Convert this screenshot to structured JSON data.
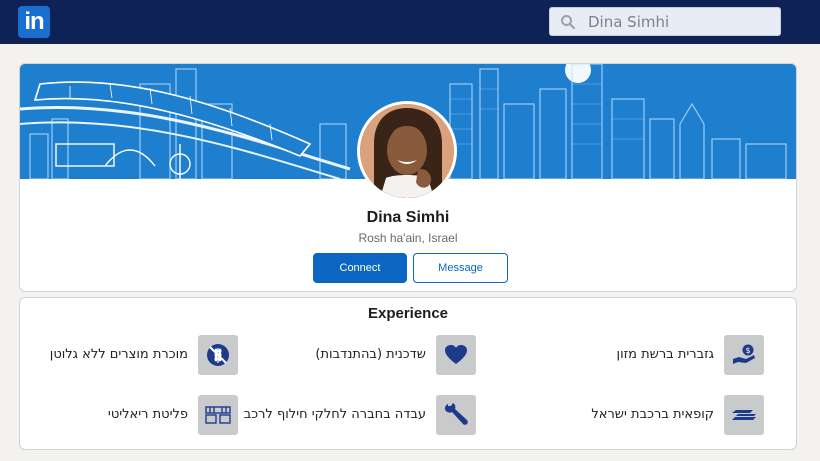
{
  "topbar": {
    "logo_text": "in",
    "search": {
      "value": "Dina Simhi",
      "icon": "search-icon"
    },
    "background": "#0e2256"
  },
  "profile": {
    "name": "Dina Simhi",
    "location": "Rosh ha'ain, Israel",
    "connect_label": "Connect",
    "message_label": "Message",
    "accent": "#0a66c2"
  },
  "experience": {
    "title": "Experience",
    "items": [
      {
        "label": "גזברית ברשת מזון",
        "icon": "hand-coin-icon"
      },
      {
        "label": "שדכנית (בהתנדבות)",
        "icon": "heart-icon"
      },
      {
        "label": "מוכרת מוצרים ללא גלוטן",
        "icon": "no-wheat-icon"
      },
      {
        "label": "קופאית ברכבת ישראל",
        "icon": "train-logo-icon"
      },
      {
        "label": "עבדה בחברה לחלקי חילוף לרכב",
        "icon": "wrench-icon"
      },
      {
        "label": "פליטת ריאליטי",
        "icon": "reality-show-logo-icon"
      }
    ]
  }
}
